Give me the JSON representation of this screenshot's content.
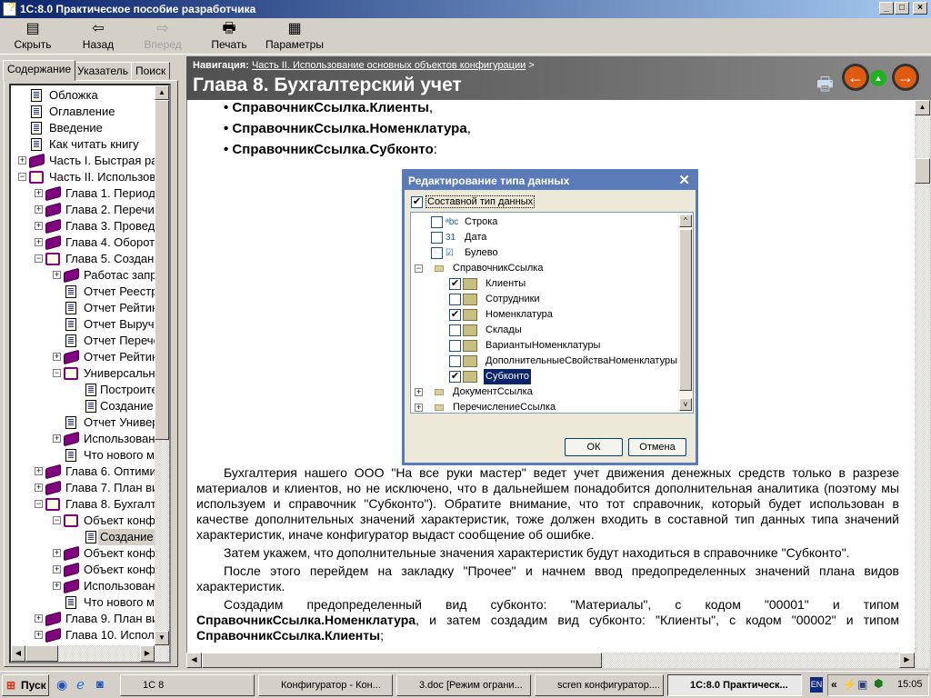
{
  "window": {
    "title": "1С:8.0  Практическое пособие разработчика"
  },
  "toolbar": {
    "hide": "Скрыть",
    "back": "Назад",
    "forward": "Вперед",
    "print": "Печать",
    "params": "Параметры"
  },
  "tabs": [
    "Содержание",
    "Указатель",
    "Поиск"
  ],
  "tree": [
    {
      "l": 0,
      "t": "doc",
      "x": "",
      "s": "Обложка"
    },
    {
      "l": 0,
      "t": "doc",
      "x": "",
      "s": "Оглавление"
    },
    {
      "l": 0,
      "t": "doc",
      "x": "",
      "s": "Введение"
    },
    {
      "l": 0,
      "t": "doc",
      "x": "",
      "s": "Как читать книгу"
    },
    {
      "l": 0,
      "t": "book",
      "x": "+",
      "s": "Часть I. Быстрая ра"
    },
    {
      "l": 0,
      "t": "open",
      "x": "-",
      "s": "Часть II. Использов"
    },
    {
      "l": 1,
      "t": "book",
      "x": "+",
      "s": "Глава 1. Период"
    },
    {
      "l": 1,
      "t": "book",
      "x": "+",
      "s": "Глава 2. Перечи"
    },
    {
      "l": 1,
      "t": "book",
      "x": "+",
      "s": "Глава 3. Провед"
    },
    {
      "l": 1,
      "t": "book",
      "x": "+",
      "s": "Глава 4. Оборот"
    },
    {
      "l": 1,
      "t": "open",
      "x": "-",
      "s": "Глава 5. Создан"
    },
    {
      "l": 2,
      "t": "book",
      "x": "+",
      "s": "Работас запр"
    },
    {
      "l": 2,
      "t": "doc",
      "x": "",
      "s": "Отчет Реестр"
    },
    {
      "l": 2,
      "t": "doc",
      "x": "",
      "s": "Отчет Рейтин"
    },
    {
      "l": 2,
      "t": "doc",
      "x": "",
      "s": "Отчет Выручк"
    },
    {
      "l": 2,
      "t": "doc",
      "x": "",
      "s": "Отчет Перече"
    },
    {
      "l": 2,
      "t": "book",
      "x": "+",
      "s": "Отчет Рейтин"
    },
    {
      "l": 2,
      "t": "open",
      "x": "-",
      "s": "Универсальн"
    },
    {
      "l": 3,
      "t": "doc",
      "x": "",
      "s": "Построите"
    },
    {
      "l": 3,
      "t": "doc",
      "x": "",
      "s": "Создание"
    },
    {
      "l": 2,
      "t": "doc",
      "x": "",
      "s": "Отчет Универ"
    },
    {
      "l": 2,
      "t": "book",
      "x": "+",
      "s": "Использован"
    },
    {
      "l": 2,
      "t": "doc",
      "x": "",
      "s": "Что нового м"
    },
    {
      "l": 1,
      "t": "book",
      "x": "+",
      "s": "Глава 6. Оптими"
    },
    {
      "l": 1,
      "t": "book",
      "x": "+",
      "s": "Глава 7. План ви"
    },
    {
      "l": 1,
      "t": "open",
      "x": "-",
      "s": "Глава 8. Бухгалт"
    },
    {
      "l": 2,
      "t": "open",
      "x": "-",
      "s": "Объект конфи"
    },
    {
      "l": 3,
      "t": "doc",
      "x": "",
      "s": "Создание",
      "sel": true
    },
    {
      "l": 2,
      "t": "book",
      "x": "+",
      "s": "Объект конфи"
    },
    {
      "l": 2,
      "t": "book",
      "x": "+",
      "s": "Объект конфи"
    },
    {
      "l": 2,
      "t": "book",
      "x": "+",
      "s": "Использован"
    },
    {
      "l": 2,
      "t": "doc",
      "x": "",
      "s": "Что нового м"
    },
    {
      "l": 1,
      "t": "book",
      "x": "+",
      "s": "Глава 9. План ви"
    },
    {
      "l": 1,
      "t": "book",
      "x": "+",
      "s": "Глава 10. Испол"
    }
  ],
  "header": {
    "nav_label": "Навигация:",
    "nav_link": "Часть II. Использование основных объектов конфигурации",
    "nav_sep": ">",
    "title": "Глава 8. Бухгалтерский учет"
  },
  "bullets": [
    {
      "b": "СправочникСсылка.Клиенты",
      "p": ","
    },
    {
      "b": "СправочникСсылка.Номенклатура",
      "p": ","
    },
    {
      "b": "СправочникСсылка.Субконто",
      "p": ":"
    }
  ],
  "dialog": {
    "title": "Редактирование типа данных",
    "composite": "Составной тип данных",
    "ok": "ОК",
    "cancel": "Отмена",
    "items": [
      {
        "l": 1,
        "cb": false,
        "s": "Строка",
        "i": "abc"
      },
      {
        "l": 1,
        "cb": false,
        "s": "Дата",
        "i": "31"
      },
      {
        "l": 1,
        "cb": false,
        "s": "Булево",
        "i": "bool"
      },
      {
        "l": 0,
        "x": "-",
        "s": "СправочникСсылка",
        "i": "folder"
      },
      {
        "l": 2,
        "cb": true,
        "s": "Клиенты",
        "i": "ref"
      },
      {
        "l": 2,
        "cb": false,
        "s": "Сотрудники",
        "i": "ref"
      },
      {
        "l": 2,
        "cb": true,
        "s": "Номенклатура",
        "i": "ref"
      },
      {
        "l": 2,
        "cb": false,
        "s": "Склады",
        "i": "ref"
      },
      {
        "l": 2,
        "cb": false,
        "s": "ВариантыНоменклатуры",
        "i": "ref"
      },
      {
        "l": 2,
        "cb": false,
        "s": "ДополнительныеСвойстваНоменклатуры",
        "i": "ref"
      },
      {
        "l": 2,
        "cb": true,
        "s": "Субконто",
        "i": "ref",
        "sel": true
      },
      {
        "l": 0,
        "x": "+",
        "s": "ДокументСсылка",
        "i": "folder"
      },
      {
        "l": 0,
        "x": "+",
        "s": "ПеречислениеСсылка",
        "i": "folder"
      }
    ]
  },
  "paragraphs": [
    "Бухгалтерия нашего ООО \"На все руки мастер\" ведет учет движения денежных средств только в разрезе материалов и клиентов, но не исключено, что в дальнейшем понадобится дополнительная аналитика (поэтому мы используем и справочник \"Субконто\"). Обратите внимание, что тот справочник, который будет использован в качестве дополнительных значений характеристик, тоже должен входить в составной тип данных типа значений характеристик, иначе конфигуратор выдаст сообщение об ошибке.",
    "Затем укажем, что дополнительные значения характеристик будут находиться в справочнике \"Субконто\".",
    "После этого перейдем на закладку \"Прочее\" и начнем ввод предопределенных значений плана видов характеристик."
  ],
  "last_para": {
    "a": "Создадим предопределенный вид субконто: \"Материалы\", с кодом \"00001\" и типом ",
    "b1": "СправочникСсылка.Номенклатура",
    "c": ", и затем создадим вид субконто: \"Клиенты\", с кодом \"00002\" и типом ",
    "b2": "СправочникСсылка.Клиенты",
    "d": ";"
  },
  "taskbar": {
    "start": "Пуск",
    "tasks": [
      "1С 8",
      "Конфигуратор - Кон...",
      "3.doc [Режим ограни...",
      "scren конфигуратор....",
      "1С:8.0  Практическ..."
    ],
    "lang": "EN",
    "clock": "15:05"
  }
}
